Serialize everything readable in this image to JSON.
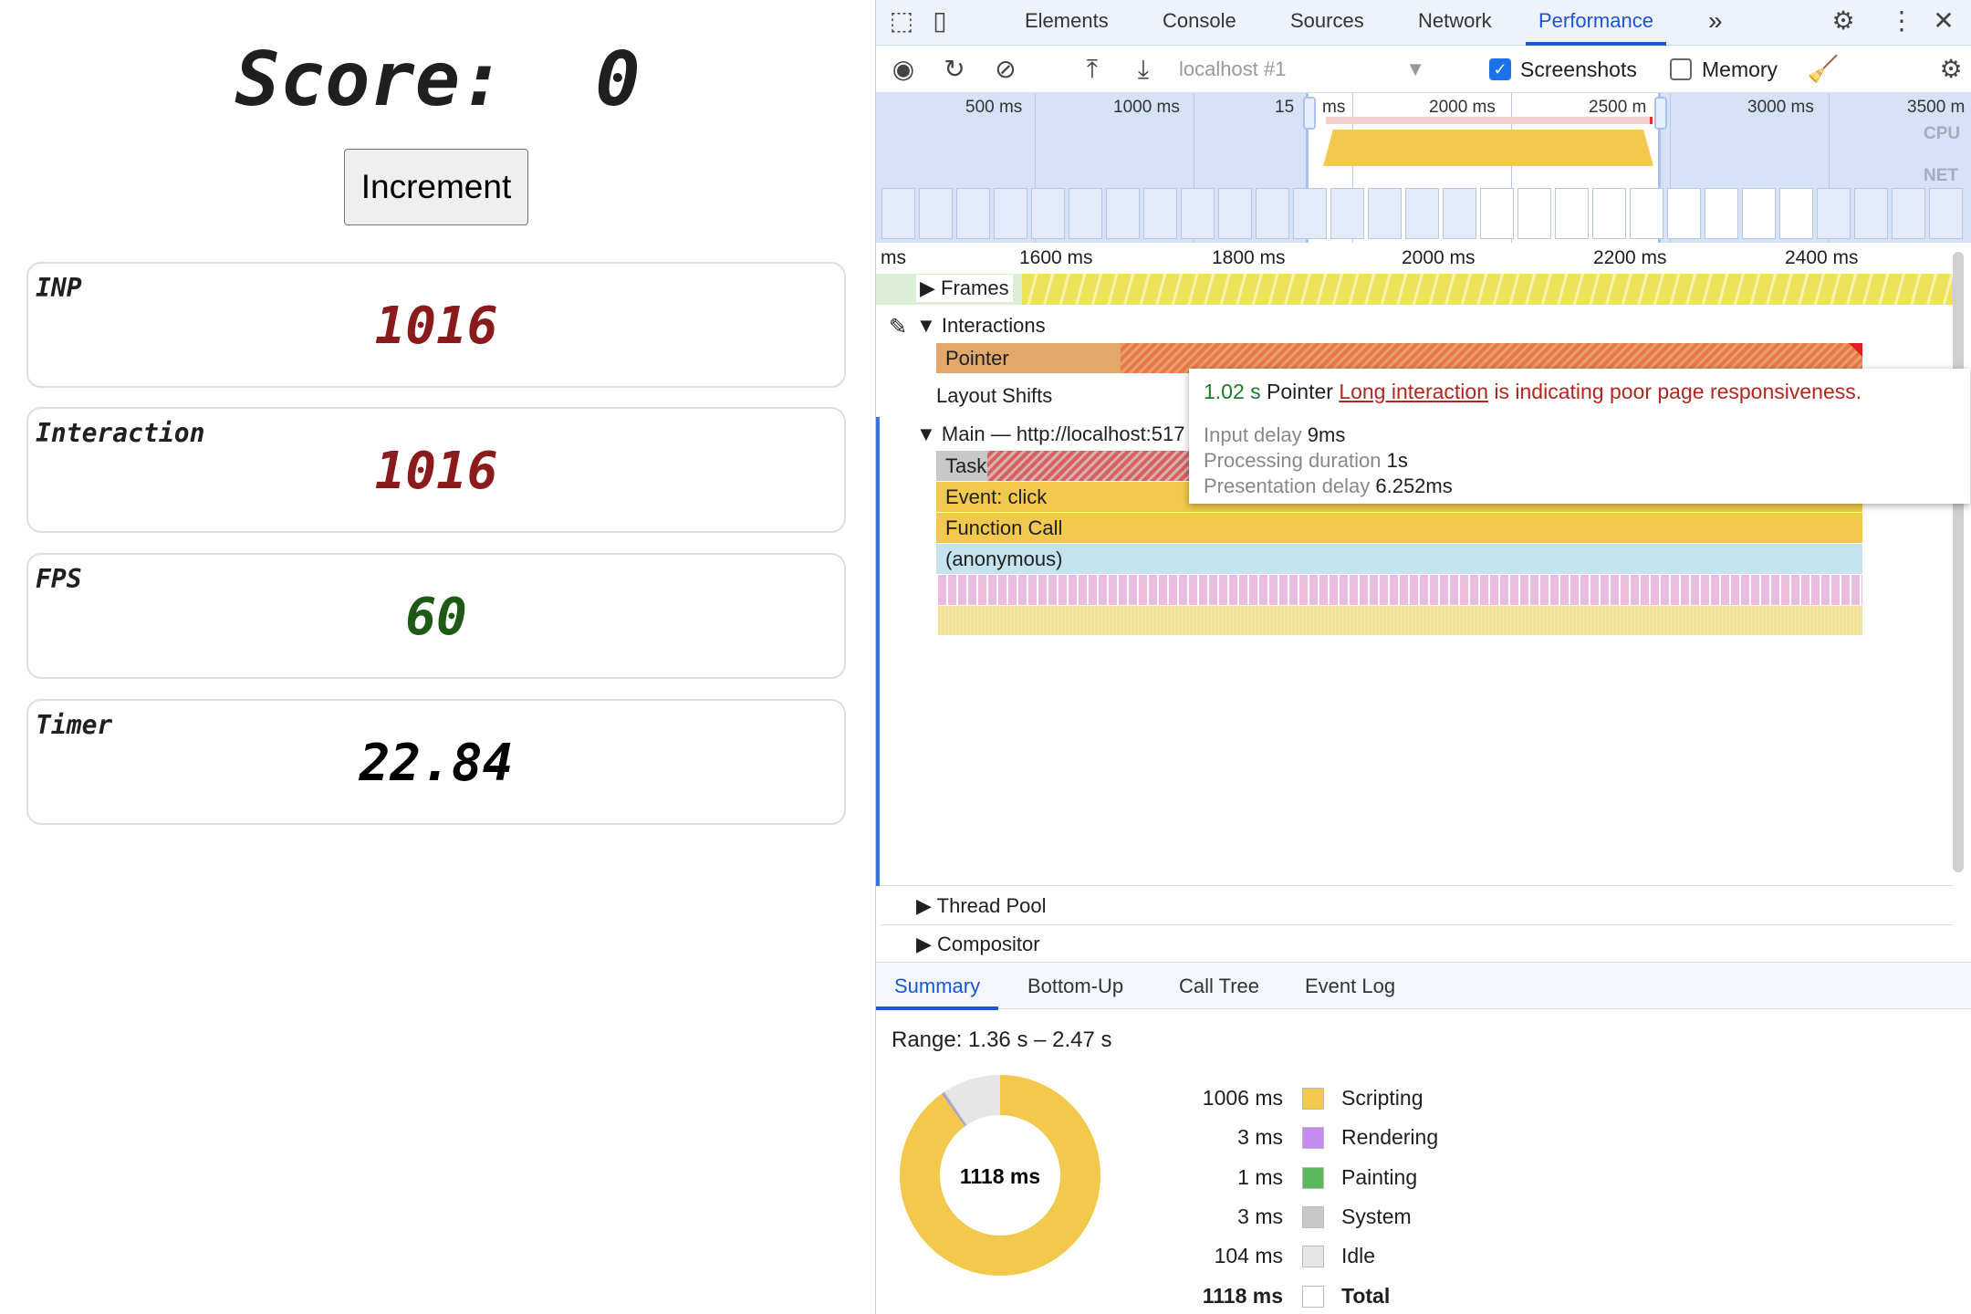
{
  "app": {
    "score_label": "Score:",
    "score": "0",
    "increment_label": "Increment",
    "cards": [
      {
        "label": "INP",
        "value": "1016",
        "color": "#8b1a1a"
      },
      {
        "label": "Interaction",
        "value": "1016",
        "color": "#8b1a1a"
      },
      {
        "label": "FPS",
        "value": "60",
        "color": "#1e5a16"
      },
      {
        "label": "Timer",
        "value": "22.84",
        "color": "#000000"
      }
    ]
  },
  "devtools": {
    "tabs": [
      "Elements",
      "Console",
      "Sources",
      "Network",
      "Performance"
    ],
    "active_tab": "Performance",
    "more": "»",
    "toolbar": {
      "target": "localhost #1",
      "screenshots_label": "Screenshots",
      "screenshots_checked": true,
      "memory_label": "Memory",
      "memory_checked": false
    },
    "overview": {
      "ticks": [
        "500 ms",
        "1000 ms",
        "15",
        "ms",
        "2000 ms",
        "2500 m",
        "3000 ms",
        "3500 m"
      ],
      "cpu_label": "CPU",
      "net_label": "NET"
    },
    "ruler": [
      "ms",
      "1600 ms",
      "1800 ms",
      "2000 ms",
      "2200 ms",
      "2400 ms"
    ],
    "tracks": {
      "frames": "Frames",
      "interactions": "Interactions",
      "pointer": "Pointer",
      "layout_shifts": "Layout Shifts",
      "main": "Main — http://localhost:517",
      "task": "Task",
      "event_click": "Event: click",
      "function_call": "Function Call",
      "anonymous": "(anonymous)",
      "thread_pool": "Thread Pool",
      "compositor": "Compositor"
    },
    "tooltip": {
      "duration": "1.02 s",
      "type": "Pointer",
      "link": "Long interaction",
      "message": " is indicating poor page responsiveness.",
      "input_delay_label": "Input delay",
      "input_delay": "9ms",
      "processing_label": "Processing duration",
      "processing": "1s",
      "presentation_label": "Presentation delay",
      "presentation": "6.252ms"
    },
    "bottom_tabs": [
      "Summary",
      "Bottom-Up",
      "Call Tree",
      "Event Log"
    ],
    "summary": {
      "range": "Range: 1.36 s – 2.47 s",
      "total_center": "1118 ms",
      "items": [
        {
          "value": "1006 ms",
          "label": "Scripting",
          "color": "#f2c94c",
          "ms": 1006
        },
        {
          "value": "3 ms",
          "label": "Rendering",
          "color": "#c58af0",
          "ms": 3
        },
        {
          "value": "1 ms",
          "label": "Painting",
          "color": "#5cb85c",
          "ms": 1
        },
        {
          "value": "3 ms",
          "label": "System",
          "color": "#c8c8c8",
          "ms": 3
        },
        {
          "value": "104 ms",
          "label": "Idle",
          "color": "#e6e6e6",
          "ms": 104
        },
        {
          "value": "1118 ms",
          "label": "Total",
          "color": "#ffffff"
        }
      ]
    }
  }
}
